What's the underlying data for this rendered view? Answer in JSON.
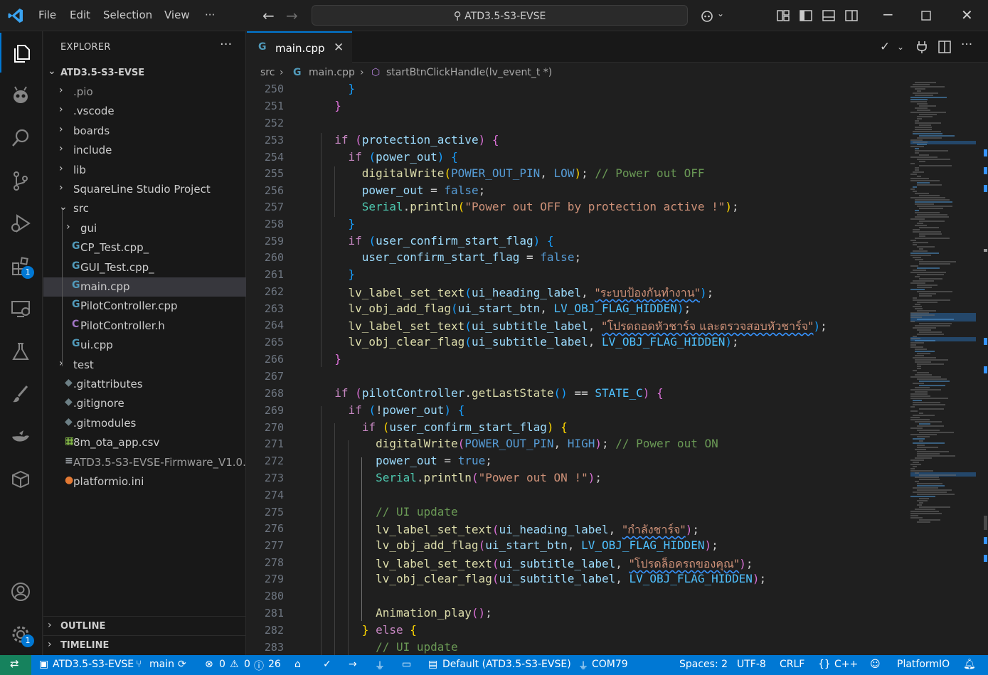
{
  "titlebar": {
    "menus": [
      "File",
      "Edit",
      "Selection",
      "View",
      "···"
    ],
    "search_text": "ATD3.5-S3-EVSE"
  },
  "activity_badges": {
    "extensions": "1",
    "manage": "1"
  },
  "explorer": {
    "title": "EXPLORER",
    "more": "···",
    "root": "ATD3.5-S3-EVSE",
    "items": [
      {
        "label": ".pio",
        "kind": "folder",
        "depth": 1,
        "state": "collapsed",
        "dim": true
      },
      {
        "label": ".vscode",
        "kind": "folder",
        "depth": 1,
        "state": "collapsed"
      },
      {
        "label": "boards",
        "kind": "folder",
        "depth": 1,
        "state": "collapsed"
      },
      {
        "label": "include",
        "kind": "folder",
        "depth": 1,
        "state": "collapsed"
      },
      {
        "label": "lib",
        "kind": "folder",
        "depth": 1,
        "state": "collapsed"
      },
      {
        "label": "SquareLine Studio Project",
        "kind": "folder",
        "depth": 1,
        "state": "collapsed"
      },
      {
        "label": "src",
        "kind": "folder",
        "depth": 1,
        "state": "expanded"
      },
      {
        "label": "gui",
        "kind": "folder",
        "depth": 2,
        "state": "collapsed"
      },
      {
        "label": "CP_Test.cpp_",
        "kind": "cpp",
        "depth": 2
      },
      {
        "label": "GUI_Test.cpp_",
        "kind": "cpp",
        "depth": 2
      },
      {
        "label": "main.cpp",
        "kind": "cpp",
        "depth": 2,
        "selected": true
      },
      {
        "label": "PilotController.cpp",
        "kind": "cpp",
        "depth": 2
      },
      {
        "label": "PilotController.h",
        "kind": "h",
        "depth": 2
      },
      {
        "label": "ui.cpp",
        "kind": "cpp",
        "depth": 2
      },
      {
        "label": "test",
        "kind": "folder",
        "depth": 1,
        "state": "collapsed"
      },
      {
        "label": ".gitattributes",
        "kind": "git",
        "depth": 1
      },
      {
        "label": ".gitignore",
        "kind": "git",
        "depth": 1
      },
      {
        "label": ".gitmodules",
        "kind": "git",
        "depth": 1
      },
      {
        "label": "8m_ota_app.csv",
        "kind": "csv",
        "depth": 1
      },
      {
        "label": "ATD3.5-S3-EVSE-Firmware_V1.0....",
        "kind": "text",
        "depth": 1,
        "dim": true
      },
      {
        "label": "platformio.ini",
        "kind": "pio",
        "depth": 1
      }
    ],
    "outline": "OUTLINE",
    "timeline": "TIMELINE"
  },
  "editor": {
    "tab_label": "main.cpp",
    "breadcrumb": [
      "src",
      "main.cpp",
      "startBtnClickHandle(lv_event_t *)"
    ],
    "line_numbers": [
      "250",
      "251",
      "252",
      "253",
      "254",
      "255",
      "256",
      "257",
      "258",
      "259",
      "260",
      "261",
      "262",
      "263",
      "264",
      "265",
      "266",
      "267",
      "268",
      "269",
      "270",
      "271",
      "272",
      "273",
      "274",
      "275",
      "276",
      "277",
      "278",
      "279",
      "280",
      "281",
      "282",
      "283"
    ],
    "strings": {
      "protect_heading": "\"ระบบป้องกันทำงาน\"",
      "protect_subtitle": "\"โปรดถอดหัวชาร์จ และตรวจสอบหัวชาร์จ\"",
      "charging_heading": "\"กำลังชาร์จ\"",
      "charging_subtitle": "\"โปรดล็อครถของคุณ\"",
      "msg_off": "\"Power out OFF by protection active !\"",
      "msg_on": "\"Power out ON !\""
    }
  },
  "statusbar": {
    "project": "ATD3.5-S3-EVSE",
    "branch": "main",
    "errors": "0",
    "warnings": "0",
    "infos": "26",
    "env": "Default (ATD3.5-S3-EVSE)",
    "port": "COM79",
    "spaces": "Spaces: 2",
    "encoding": "UTF-8",
    "eol": "CRLF",
    "language": "C++",
    "platformio": "PlatformIO"
  },
  "colors": {
    "accent": "#0078d4",
    "statusbar": "#0078d4",
    "remote": "#16825d"
  }
}
